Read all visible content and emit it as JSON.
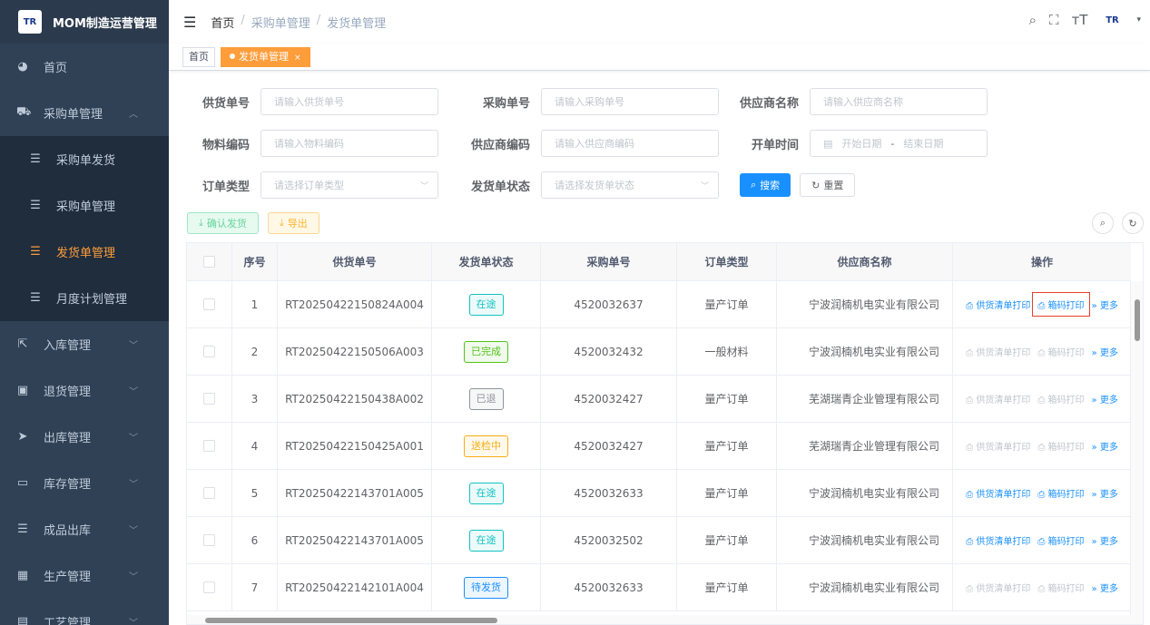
{
  "sidebar": {
    "logo_mark": "TR",
    "title": "MOM制造运营管理",
    "items": [
      {
        "label": "首页",
        "icon": "dashboard-icon",
        "glyph": "◕"
      },
      {
        "label": "采购单管理",
        "icon": "cart-icon",
        "glyph": "⛟"
      },
      {
        "label": "采购单发货",
        "icon": "list-icon",
        "glyph": "☰"
      },
      {
        "label": "采购单管理",
        "icon": "list-icon",
        "glyph": "☰"
      },
      {
        "label": "发货单管理",
        "icon": "list-icon",
        "glyph": "☰"
      },
      {
        "label": "月度计划管理",
        "icon": "list-icon",
        "glyph": "☰"
      },
      {
        "label": "入库管理",
        "icon": "edit-icon",
        "glyph": "⇱"
      },
      {
        "label": "退货管理",
        "icon": "return-icon",
        "glyph": "▣"
      },
      {
        "label": "出库管理",
        "icon": "send-icon",
        "glyph": "➤"
      },
      {
        "label": "库存管理",
        "icon": "inventory-icon",
        "glyph": "▭"
      },
      {
        "label": "成品出库",
        "icon": "list-icon",
        "glyph": "☰"
      },
      {
        "label": "生产管理",
        "icon": "production-icon",
        "glyph": "▦"
      },
      {
        "label": "工艺管理",
        "icon": "process-icon",
        "glyph": "▤"
      }
    ],
    "active_color": "#ff9d3b"
  },
  "header": {
    "breadcrumb": [
      "首页",
      "采购单管理",
      "发货单管理"
    ],
    "separator": "/"
  },
  "tags": {
    "home": "首页",
    "active": "发货单管理",
    "close": "×"
  },
  "form": {
    "supply_no": {
      "label": "供货单号",
      "placeholder": "请输入供货单号"
    },
    "purchase_no": {
      "label": "采购单号",
      "placeholder": "请输入采购单号"
    },
    "supplier_name": {
      "label": "供应商名称",
      "placeholder": "请输入供应商名称"
    },
    "material_code": {
      "label": "物料编码",
      "placeholder": "请输入物料编码"
    },
    "supplier_code": {
      "label": "供应商编码",
      "placeholder": "请输入供应商编码"
    },
    "open_time": {
      "label": "开单时间",
      "start": "开始日期",
      "dash": "-",
      "end": "结束日期"
    },
    "order_type": {
      "label": "订单类型",
      "placeholder": "请选择订单类型"
    },
    "ship_status": {
      "label": "发货单状态",
      "placeholder": "请选择发货单状态"
    },
    "search_label": "搜索",
    "reset_label": "重置"
  },
  "toolbar": {
    "confirm_label": "确认发货",
    "export_label": "导出"
  },
  "table": {
    "headers": [
      "序号",
      "供货单号",
      "发货单状态",
      "采购单号",
      "订单类型",
      "供应商名称",
      "操作"
    ],
    "op_labels": {
      "print_list": "供货清单打印",
      "print_box": "箱码打印",
      "more": "更多"
    },
    "rows": [
      {
        "idx": "1",
        "supply_no": "RT20250422150824A004",
        "status": "在途",
        "status_color": "#13c2c2",
        "purchase_no": "4520032637",
        "order_type": "量产订单",
        "supplier": "宁波润楠机电实业有限公司",
        "print_enabled": true
      },
      {
        "idx": "2",
        "supply_no": "RT20250422150506A003",
        "status": "已完成",
        "status_color": "#52c41a",
        "purchase_no": "4520032432",
        "order_type": "一般材料",
        "supplier": "宁波润楠机电实业有限公司",
        "print_enabled": false
      },
      {
        "idx": "3",
        "supply_no": "RT20250422150438A002",
        "status": "已退",
        "status_color": "#909399",
        "purchase_no": "4520032427",
        "order_type": "量产订单",
        "supplier": "芜湖瑞青企业管理有限公司",
        "print_enabled": false
      },
      {
        "idx": "4",
        "supply_no": "RT20250422150425A001",
        "status": "送检中",
        "status_color": "#faad14",
        "purchase_no": "4520032427",
        "order_type": "量产订单",
        "supplier": "芜湖瑞青企业管理有限公司",
        "print_enabled": false
      },
      {
        "idx": "5",
        "supply_no": "RT20250422143701A005",
        "status": "在途",
        "status_color": "#13c2c2",
        "purchase_no": "4520032633",
        "order_type": "量产订单",
        "supplier": "宁波润楠机电实业有限公司",
        "print_enabled": true
      },
      {
        "idx": "6",
        "supply_no": "RT20250422143701A005",
        "status": "在途",
        "status_color": "#13c2c2",
        "purchase_no": "4520032502",
        "order_type": "量产订单",
        "supplier": "宁波润楠机电实业有限公司",
        "print_enabled": true
      },
      {
        "idx": "7",
        "supply_no": "RT20250422142101A004",
        "status": "待发货",
        "status_color": "#1890ff",
        "purchase_no": "4520032633",
        "order_type": "量产订单",
        "supplier": "宁波润楠机电实业有限公司",
        "print_enabled": false
      }
    ]
  }
}
